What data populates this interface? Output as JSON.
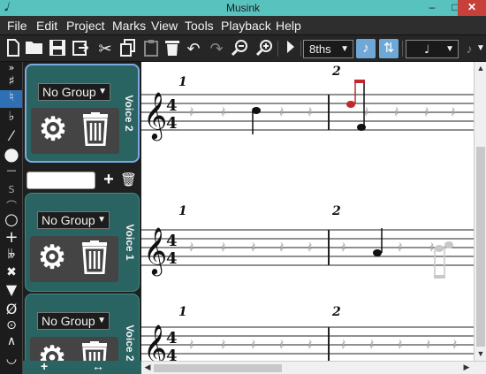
{
  "window": {
    "title": "Musink",
    "app_icon": "musink-logo-icon",
    "min": "–",
    "max": "□",
    "close": "✕"
  },
  "menu": [
    "File",
    "Edit",
    "Project",
    "Marks",
    "View",
    "Tools",
    "Playback",
    "Help"
  ],
  "toolbar": {
    "note_value": "8ths",
    "buttons": [
      "new-icon",
      "open-icon",
      "save-icon",
      "export-icon",
      "cut-icon",
      "copy-icon",
      "paste-icon",
      "delete-icon",
      "undo-icon",
      "redo-icon",
      "zoom-out-icon",
      "zoom-in-icon",
      "play-icon"
    ]
  },
  "voices": [
    {
      "name": "Voice 2",
      "group": "No Group"
    },
    {
      "name": "Voice 1",
      "group": "No Group"
    },
    {
      "name": "Voice 2",
      "group": "No Group"
    }
  ],
  "voice_name_input": "",
  "systems": [
    {
      "measures": [
        "1",
        "2"
      ]
    },
    {
      "measures": [
        "1",
        "2"
      ]
    },
    {
      "measures": [
        "1",
        "2"
      ]
    }
  ],
  "time_signature": {
    "top": "4",
    "bottom": "4"
  },
  "colors": {
    "accent": "#2a6462",
    "titlebar": "#58c2be",
    "highlight_note": "#c0282c",
    "close": "#c7413a"
  }
}
